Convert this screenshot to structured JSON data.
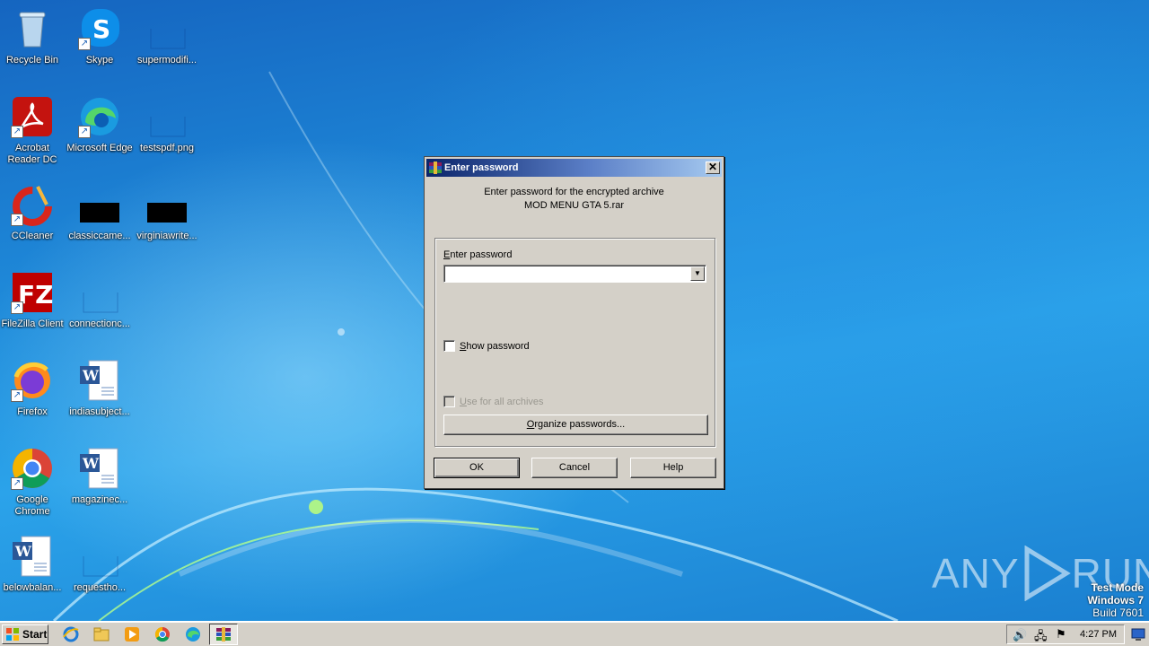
{
  "desktop": {
    "icons": [
      {
        "label": "Recycle Bin"
      },
      {
        "label": "Skype"
      },
      {
        "label": "supermodifi..."
      },
      {
        "label": "Acrobat Reader DC"
      },
      {
        "label": "Microsoft Edge"
      },
      {
        "label": "testspdf.png"
      },
      {
        "label": "CCleaner"
      },
      {
        "label": "classiccame..."
      },
      {
        "label": "virginiawrite..."
      },
      {
        "label": "FileZilla Client"
      },
      {
        "label": "connectionc..."
      },
      {
        "label": "Firefox"
      },
      {
        "label": "indiasubject..."
      },
      {
        "label": "Google Chrome"
      },
      {
        "label": "magazinec..."
      },
      {
        "label": "belowbalan..."
      },
      {
        "label": "requestho..."
      }
    ]
  },
  "dialog": {
    "title": "Enter password",
    "close_glyph": "✕",
    "message_line1": "Enter password for the encrypted archive",
    "message_line2": "MOD MENU GTA 5.rar",
    "password_label_first": "E",
    "password_label_rest": "nter password",
    "password_value": "",
    "show_password_first": "S",
    "show_password_rest": "how password",
    "use_all_first": "U",
    "use_all_rest": "se for all archives",
    "organize_first": "O",
    "organize_rest": "rganize passwords...",
    "ok_label": "OK",
    "cancel_label": "Cancel",
    "help_label": "Help"
  },
  "watermark": {
    "brand_left": "ANY",
    "brand_right": "RUN",
    "mode_line1": "Test Mode",
    "mode_line2": "Windows 7",
    "mode_line3": "Build 7601"
  },
  "taskbar": {
    "start_label": "Start",
    "clock": "4:27 PM"
  },
  "colors": {
    "titlebar_start": "#0a246a",
    "titlebar_end": "#a6caf0",
    "dialog_face": "#d4d0c8"
  }
}
